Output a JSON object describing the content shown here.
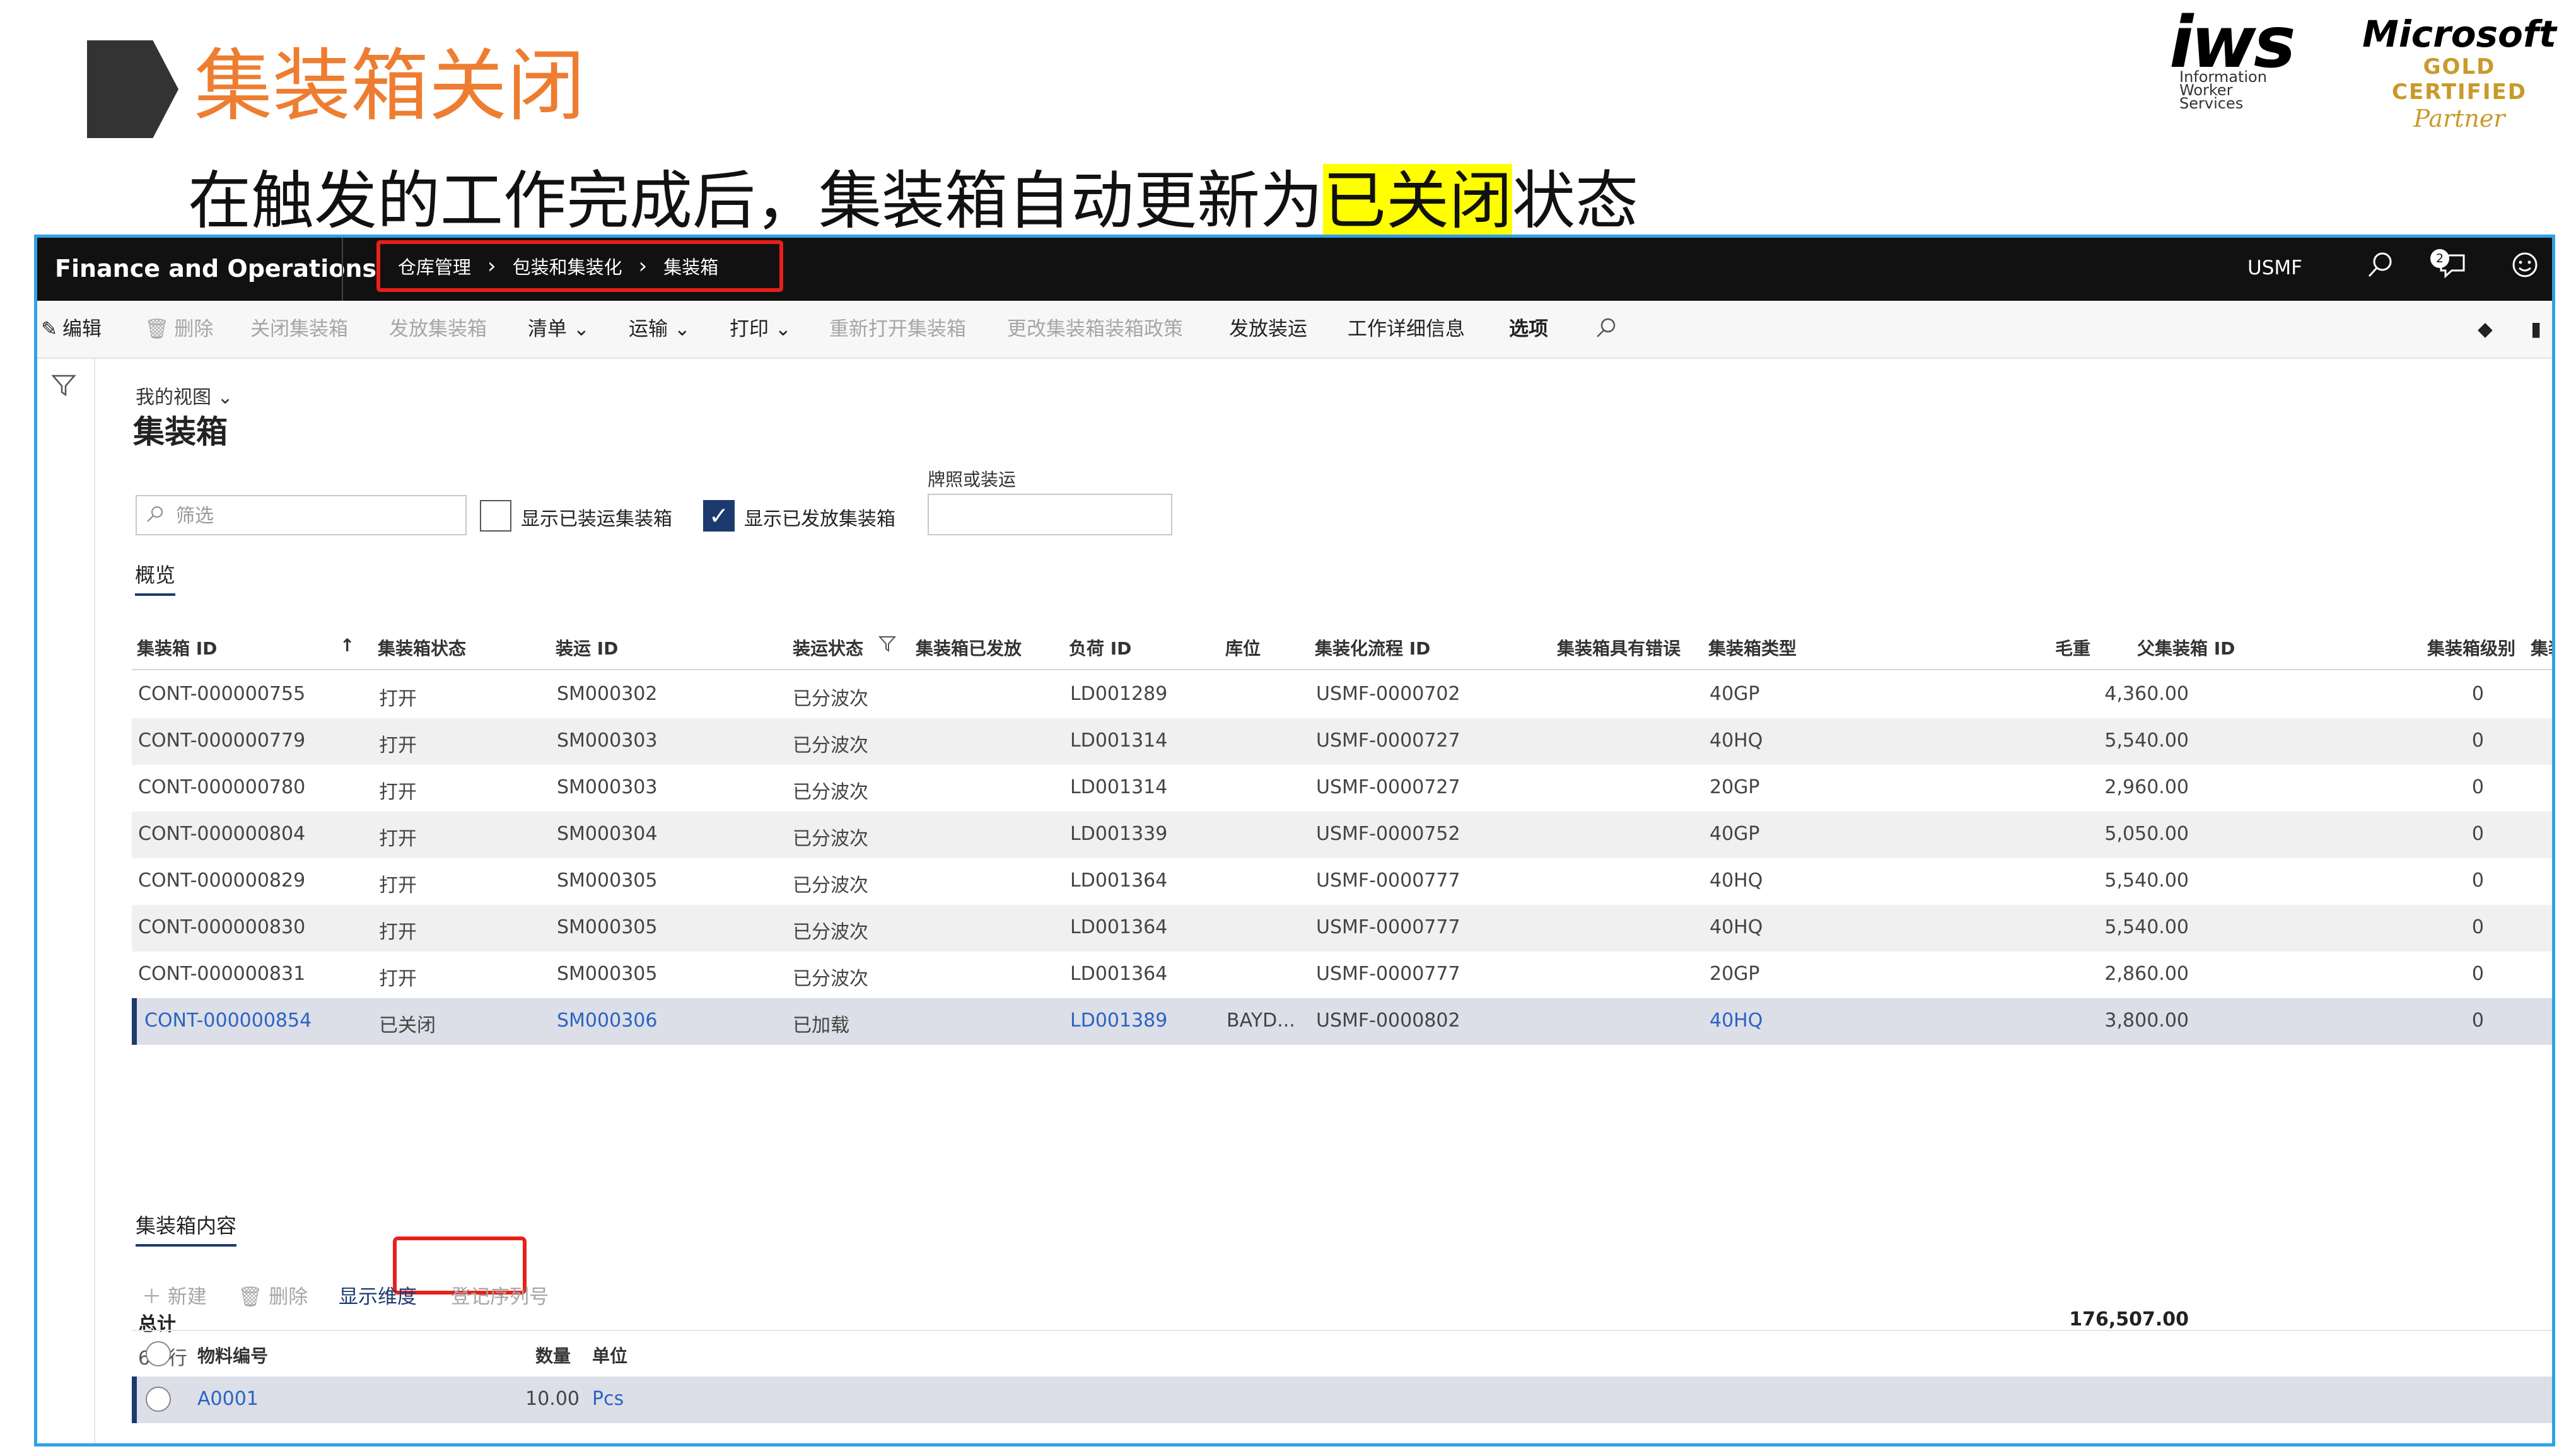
{
  "slide": {
    "title": "集装箱关闭",
    "subtitle_before": "在触发的工作完成后，集装箱自动更新为",
    "subtitle_highlight": "已关闭",
    "subtitle_after": "状态",
    "logo_iws_main": "iws",
    "logo_iws_sub": "Information\nWorker\nServices",
    "logo_ms_line1": "Microsoft",
    "logo_ms_line2": "GOLD CERTIFIED",
    "logo_ms_line3": "Partner"
  },
  "topbar": {
    "app_name": "Finance and Operations",
    "breadcrumb": [
      "仓库管理",
      "包装和集装化",
      "集装箱"
    ],
    "company": "USMF",
    "notification_count": "2"
  },
  "actions": {
    "edit": "编辑",
    "delete": "删除",
    "close_container": "关闭集装箱",
    "release_container": "发放集装箱",
    "list": "清单",
    "transport": "运输",
    "print": "打印",
    "reopen_container": "重新打开集装箱",
    "change_policy": "更改集装箱装箱政策",
    "release_shipment": "发放装运",
    "work_details": "工作详细信息",
    "options": "选项"
  },
  "page": {
    "my_view": "我的视图",
    "title": "集装箱",
    "filter_placeholder": "筛选",
    "show_shipped": "显示已装运集装箱",
    "show_released": "显示已发放集装箱",
    "show_released_checked": true,
    "plate_label": "牌照或装运",
    "overview_tab": "概览"
  },
  "grid": {
    "columns": [
      "集装箱 ID",
      "集装箱状态",
      "装运 ID",
      "装运状态",
      "集装箱已发放",
      "负荷 ID",
      "库位",
      "集装化流程 ID",
      "集装箱具有错误",
      "集装箱类型",
      "毛重",
      "父集装箱 ID",
      "集装箱级别",
      "集装箱"
    ],
    "rows": [
      {
        "id": "CONT-000000755",
        "status": "打开",
        "shipment": "SM000302",
        "ship_status": "已分波次",
        "load": "LD001289",
        "location": "",
        "process": "USMF-0000702",
        "type": "40GP",
        "weight": "4,360.00",
        "level": "0"
      },
      {
        "id": "CONT-000000779",
        "status": "打开",
        "shipment": "SM000303",
        "ship_status": "已分波次",
        "load": "LD001314",
        "location": "",
        "process": "USMF-0000727",
        "type": "40HQ",
        "weight": "5,540.00",
        "level": "0"
      },
      {
        "id": "CONT-000000780",
        "status": "打开",
        "shipment": "SM000303",
        "ship_status": "已分波次",
        "load": "LD001314",
        "location": "",
        "process": "USMF-0000727",
        "type": "20GP",
        "weight": "2,960.00",
        "level": "0"
      },
      {
        "id": "CONT-000000804",
        "status": "打开",
        "shipment": "SM000304",
        "ship_status": "已分波次",
        "load": "LD001339",
        "location": "",
        "process": "USMF-0000752",
        "type": "40GP",
        "weight": "5,050.00",
        "level": "0"
      },
      {
        "id": "CONT-000000829",
        "status": "打开",
        "shipment": "SM000305",
        "ship_status": "已分波次",
        "load": "LD001364",
        "location": "",
        "process": "USMF-0000777",
        "type": "40HQ",
        "weight": "5,540.00",
        "level": "0"
      },
      {
        "id": "CONT-000000830",
        "status": "打开",
        "shipment": "SM000305",
        "ship_status": "已分波次",
        "load": "LD001364",
        "location": "",
        "process": "USMF-0000777",
        "type": "40HQ",
        "weight": "5,540.00",
        "level": "0"
      },
      {
        "id": "CONT-000000831",
        "status": "打开",
        "shipment": "SM000305",
        "ship_status": "已分波次",
        "load": "LD001364",
        "location": "",
        "process": "USMF-0000777",
        "type": "20GP",
        "weight": "2,860.00",
        "level": "0"
      },
      {
        "id": "CONT-000000854",
        "status": "已关闭",
        "shipment": "SM000306",
        "ship_status": "已加载",
        "load": "LD001389",
        "location": "BAYD...",
        "process": "USMF-0000802",
        "type": "40HQ",
        "weight": "3,800.00",
        "level": "0"
      }
    ],
    "total_label": "总计",
    "total_weight": "176,507.00",
    "row_count": "69 行"
  },
  "contents": {
    "tab": "集装箱内容",
    "new": "新建",
    "delete": "删除",
    "show_dimensions": "显示维度",
    "register_serials": "登记序列号",
    "columns": [
      "物料编号",
      "数量",
      "单位"
    ],
    "rows": [
      {
        "item": "A0001",
        "qty": "10.00",
        "unit": "Pcs"
      }
    ]
  },
  "colors": {
    "accent_orange": "#ee7d31",
    "highlight_yellow": "#ffff00",
    "frame_blue": "#2ea3e6",
    "callout_red": "#e8201a",
    "link_blue": "#2a63c4",
    "nav_navy": "#1d3a6e"
  }
}
